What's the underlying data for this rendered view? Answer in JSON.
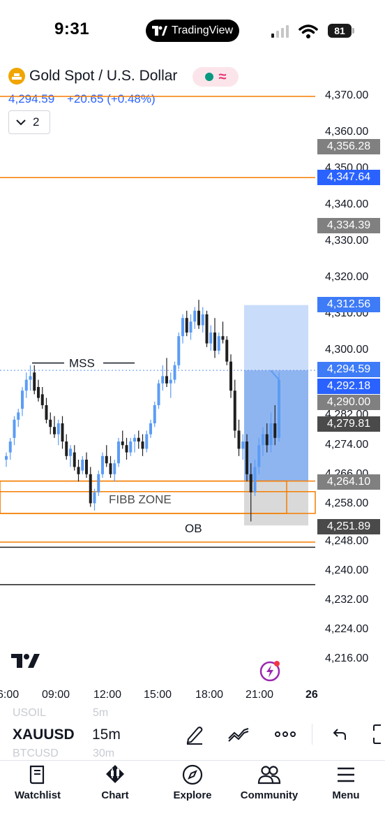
{
  "status_bar": {
    "time": "9:31",
    "app_name": "TradingView",
    "battery": "81"
  },
  "chart": {
    "symbol_title": "Gold Spot / U.S. Dollar",
    "last_price": "4,294.59",
    "change": "+20.65 (+0.48%)",
    "collapse_count": "2",
    "price_ticks": [
      "4,370.00",
      "4,360.00",
      "4,350.00",
      "4,340.00",
      "4,330.00",
      "4,320.00",
      "4,310.00",
      "4,300.00",
      "4,282.00",
      "4,274.00",
      "4,266.00",
      "4,258.00",
      "4,248.00",
      "4,240.00",
      "4,232.00",
      "4,224.00",
      "4,216.00"
    ],
    "price_labels": [
      {
        "text": "4,356.28",
        "color": "#808080"
      },
      {
        "text": "4,347.64",
        "color": "#2962ff"
      },
      {
        "text": "4,334.39",
        "color": "#808080"
      },
      {
        "text": "4,312.56",
        "color": "#3d7bf7"
      },
      {
        "text": "4,294.59",
        "color": "#3d7bf7"
      },
      {
        "text": "4,292.18",
        "color": "#2962ff"
      },
      {
        "text": "4,290.00",
        "color": "#808080"
      },
      {
        "text": "4,279.81",
        "color": "#4a4a4a"
      },
      {
        "text": "4,264.10",
        "color": "#808080"
      },
      {
        "text": "4,251.89",
        "color": "#4a4a4a"
      }
    ],
    "time_ticks": [
      "6:00",
      "09:00",
      "12:00",
      "15:00",
      "18:00",
      "21:00",
      "26"
    ],
    "annotations": {
      "mss": "MSS",
      "fibb_zone": "FIBB ZONE",
      "ob": "OB"
    },
    "colors": {
      "up": "#5b9cf5",
      "down": "#1f1f1f",
      "level_line": "#f57c00",
      "accent": "#2962ff"
    }
  },
  "toolbar": {
    "symbol": "XAUUSD",
    "symbol_above": "USOIL",
    "symbol_below": "BTCUSD",
    "timeframe": "15m",
    "timeframe_above": "5m",
    "timeframe_below": "30m"
  },
  "tabs": [
    {
      "label": "Watchlist",
      "icon": "book-icon"
    },
    {
      "label": "Chart",
      "icon": "candles-icon"
    },
    {
      "label": "Explore",
      "icon": "compass-icon"
    },
    {
      "label": "Community",
      "icon": "people-icon"
    },
    {
      "label": "Menu",
      "icon": "hamburger-icon"
    }
  ]
}
